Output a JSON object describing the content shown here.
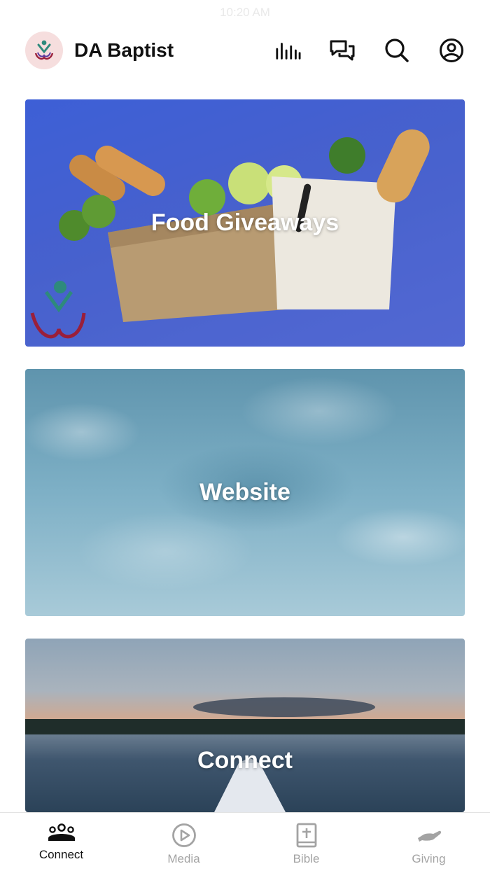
{
  "status_bar": {
    "time": "10:20 AM"
  },
  "header": {
    "title": "DA Baptist",
    "icons": [
      "bar-chart-icon",
      "chat-bubbles-icon",
      "search-icon",
      "profile-icon"
    ]
  },
  "cards": [
    {
      "title": "Food Giveaways",
      "image": "food-bags-image"
    },
    {
      "title": "Website",
      "image": "water-surface-image"
    },
    {
      "title": "Connect",
      "image": "lake-kayak-image"
    }
  ],
  "bottom_nav": {
    "items": [
      {
        "label": "Connect",
        "icon": "people-group-icon",
        "active": true
      },
      {
        "label": "Media",
        "icon": "play-circle-icon",
        "active": false
      },
      {
        "label": "Bible",
        "icon": "bible-icon",
        "active": false
      },
      {
        "label": "Giving",
        "icon": "giving-hand-icon",
        "active": false
      }
    ]
  },
  "colors": {
    "active": "#111111",
    "inactive": "#a3a3a3",
    "logo_bg": "#f6dede"
  }
}
